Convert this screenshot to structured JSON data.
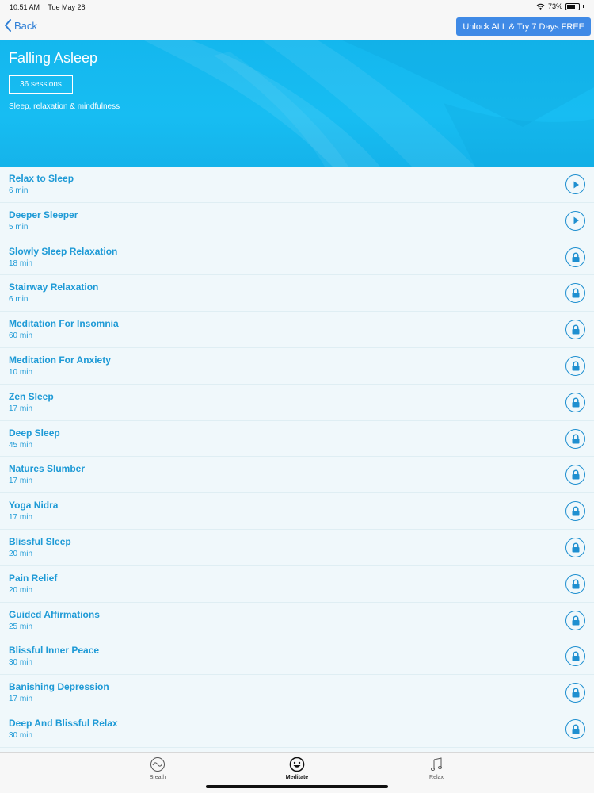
{
  "status": {
    "time": "10:51 AM",
    "date": "Tue May 28",
    "battery": "73%",
    "battery_level": 0.73
  },
  "nav": {
    "back_label": "Back",
    "unlock_label": "Unlock ALL & Try 7 Days FREE"
  },
  "hero": {
    "title": "Falling Asleep",
    "sessions_badge": "36 sessions",
    "subtitle": "Sleep, relaxation & mindfulness"
  },
  "sessions": [
    {
      "title": "Relax to Sleep",
      "duration": "6 min",
      "icon": "play-icon"
    },
    {
      "title": "Deeper Sleeper",
      "duration": "5 min",
      "icon": "play-icon"
    },
    {
      "title": "Slowly Sleep Relaxation",
      "duration": "18 min",
      "icon": "lock-icon"
    },
    {
      "title": "Stairway Relaxation",
      "duration": "6 min",
      "icon": "lock-icon"
    },
    {
      "title": "Meditation For Insomnia",
      "duration": "60 min",
      "icon": "lock-icon"
    },
    {
      "title": "Meditation For Anxiety",
      "duration": "10 min",
      "icon": "lock-icon"
    },
    {
      "title": "Zen Sleep",
      "duration": "17 min",
      "icon": "lock-icon"
    },
    {
      "title": "Deep Sleep",
      "duration": "45 min",
      "icon": "lock-icon"
    },
    {
      "title": "Natures Slumber",
      "duration": "17 min",
      "icon": "lock-icon"
    },
    {
      "title": "Yoga Nidra",
      "duration": "17 min",
      "icon": "lock-icon"
    },
    {
      "title": "Blissful Sleep",
      "duration": "20 min",
      "icon": "lock-icon"
    },
    {
      "title": "Pain Relief",
      "duration": "20 min",
      "icon": "lock-icon"
    },
    {
      "title": "Guided Affirmations",
      "duration": "25 min",
      "icon": "lock-icon"
    },
    {
      "title": "Blissful Inner Peace",
      "duration": "30 min",
      "icon": "lock-icon"
    },
    {
      "title": "Banishing Depression",
      "duration": "17 min",
      "icon": "lock-icon"
    },
    {
      "title": "Deep And Blissful Relax",
      "duration": "30 min",
      "icon": "lock-icon"
    }
  ],
  "tabs": [
    {
      "label": "Breath",
      "icon": "wave-icon",
      "active": false
    },
    {
      "label": "Meditate",
      "icon": "smile-icon",
      "active": true
    },
    {
      "label": "Relax",
      "icon": "music-note-icon",
      "active": false
    }
  ],
  "colors": {
    "accent": "#1e9ad6",
    "hero": "#17bdf2",
    "button": "#3f8ae6"
  }
}
